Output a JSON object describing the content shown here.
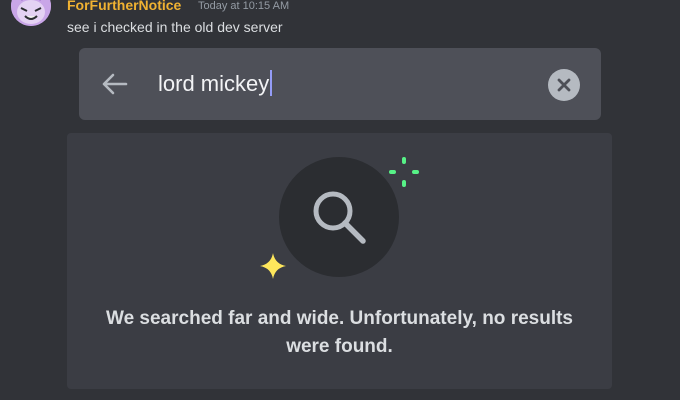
{
  "message": {
    "username": "ForFurtherNotice",
    "timestamp": "Today at 10:15 AM",
    "text": "see i checked in the old dev server",
    "username_color": "#f0b232",
    "avatar_icon": "cartoon-character-avatar"
  },
  "search": {
    "value": "lord mickey",
    "back_icon": "arrow-left-icon",
    "clear_icon": "close-circle-icon"
  },
  "results": {
    "empty_line1": "We searched far and wide. Unfortunately, no results",
    "empty_line2": "were found.",
    "illustration_icon": "magnifying-glass-icon",
    "accent_green": "#57f287",
    "accent_yellow": "#fee75c"
  }
}
